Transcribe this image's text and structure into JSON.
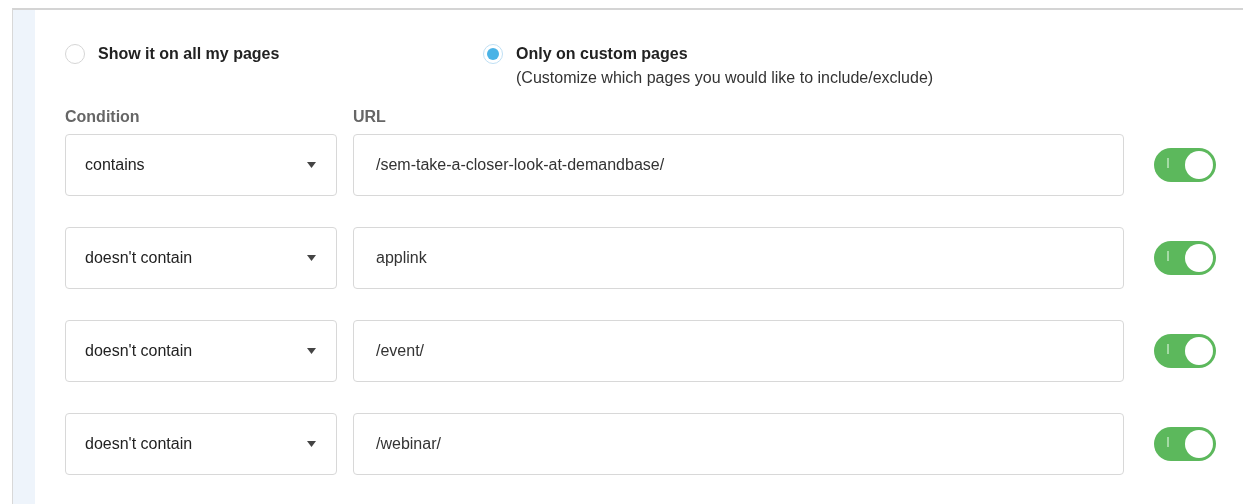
{
  "visibility": [
    {
      "label": "Show it on all my pages",
      "selected": false
    },
    {
      "label": "Only on custom pages",
      "note": "(Customize which pages you would like to include/exclude)",
      "selected": true
    }
  ],
  "columns": [
    "Condition",
    "URL"
  ],
  "rules": [
    {
      "condition": "contains",
      "url": "/sem-take-a-closer-look-at-demandbase/",
      "on": true
    },
    {
      "condition": "doesn't contain",
      "url": "applink",
      "on": true
    },
    {
      "condition": "doesn't contain",
      "url": "/event/",
      "on": true
    },
    {
      "condition": "doesn't contain",
      "url": "/webinar/",
      "on": true
    }
  ]
}
